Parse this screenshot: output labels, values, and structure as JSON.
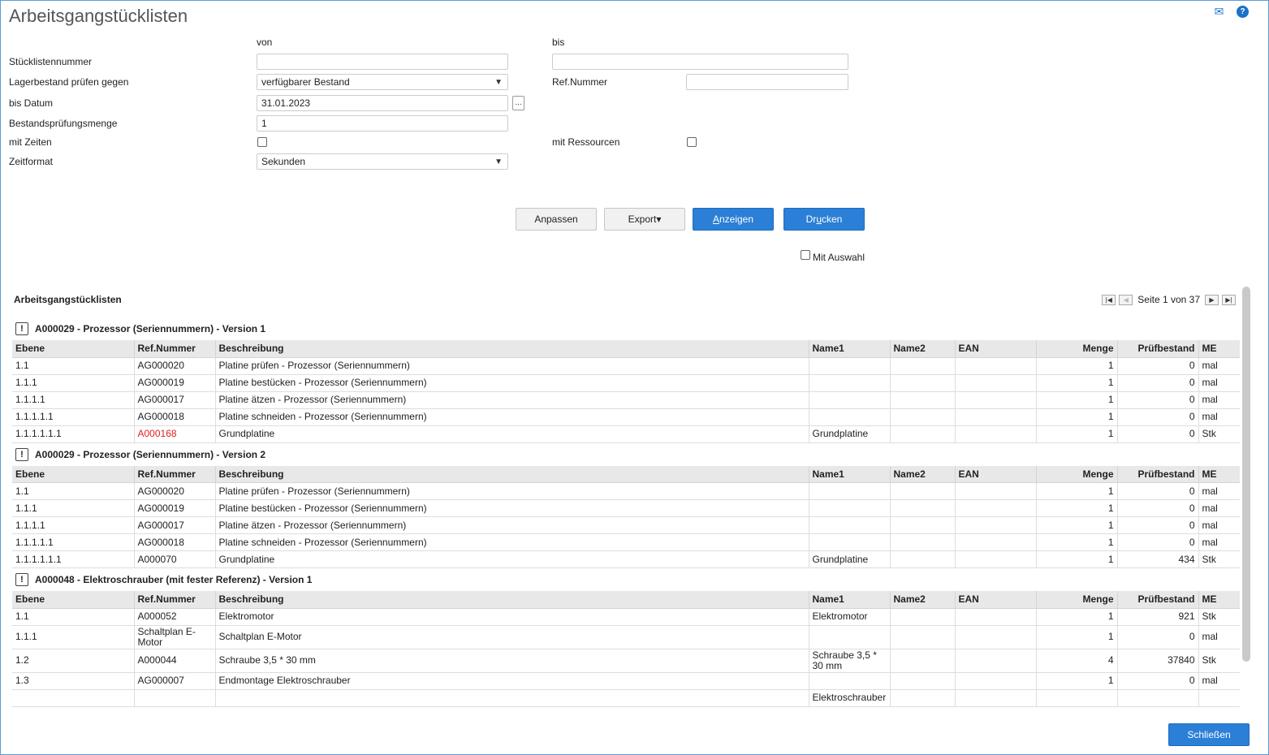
{
  "header": {
    "title": "Arbeitsgangstücklisten",
    "mail_icon": "mail-icon",
    "help_icon": "help-icon"
  },
  "form": {
    "von": "von",
    "bis": "bis",
    "stuecklistennummer_label": "Stücklistennummer",
    "lagerbestand_label": "Lagerbestand prüfen gegen",
    "lagerbestand_value": "verfügbarer Bestand",
    "refnummer_label": "Ref.Nummer",
    "bisdatum_label": "bis Datum",
    "bisdatum_value": "31.01.2023",
    "date_btn": "...",
    "menge_label": "Bestandsprüfungsmenge",
    "menge_value": "1",
    "mitzeiten_label": "mit Zeiten",
    "mitressourcen_label": "mit Ressourcen",
    "zeitformat_label": "Zeitformat",
    "zeitformat_value": "Sekunden"
  },
  "actions": {
    "anpassen": "Anpassen",
    "export": "Export▾",
    "anzeigen_u": "A",
    "anzeigen_rest": "nzeigen",
    "drucken_pre": "Dr",
    "drucken_u": "u",
    "drucken_post": "cken",
    "mit_auswahl": "Mit Auswahl",
    "schliessen": "Schließen"
  },
  "results": {
    "title": "Arbeitsgangstücklisten",
    "pager": "Seite 1 von 37",
    "columns": [
      "Ebene",
      "Ref.Nummer",
      "Beschreibung",
      "Name1",
      "Name2",
      "EAN",
      "Menge",
      "Prüfbestand",
      "ME"
    ],
    "groups": [
      {
        "title": "A000029 - Prozessor (Seriennummern) - Version 1",
        "rows": [
          {
            "ebene": "1.1",
            "ref": "AG000020",
            "beschr": "Platine prüfen - Prozessor (Seriennummern)",
            "name1": "",
            "name2": "",
            "ean": "",
            "menge": "1",
            "pruef": "0",
            "me": "mal"
          },
          {
            "ebene": "1.1.1",
            "ref": "AG000019",
            "beschr": "Platine bestücken - Prozessor (Seriennummern)",
            "name1": "",
            "name2": "",
            "ean": "",
            "menge": "1",
            "pruef": "0",
            "me": "mal"
          },
          {
            "ebene": "1.1.1.1",
            "ref": "AG000017",
            "beschr": "Platine ätzen - Prozessor (Seriennummern)",
            "name1": "",
            "name2": "",
            "ean": "",
            "menge": "1",
            "pruef": "0",
            "me": "mal"
          },
          {
            "ebene": "1.1.1.1.1",
            "ref": "AG000018",
            "beschr": "Platine schneiden - Prozessor (Seriennummern)",
            "name1": "",
            "name2": "",
            "ean": "",
            "menge": "1",
            "pruef": "0",
            "me": "mal"
          },
          {
            "ebene": "1.1.1.1.1.1",
            "ref": "A000168",
            "ref_red": true,
            "beschr": "Grundplatine",
            "name1": "Grundplatine",
            "name2": "",
            "ean": "",
            "menge": "1",
            "pruef": "0",
            "me": "Stk"
          }
        ]
      },
      {
        "title": "A000029 - Prozessor (Seriennummern) - Version 2",
        "rows": [
          {
            "ebene": "1.1",
            "ref": "AG000020",
            "beschr": "Platine prüfen - Prozessor (Seriennummern)",
            "name1": "",
            "name2": "",
            "ean": "",
            "menge": "1",
            "pruef": "0",
            "me": "mal"
          },
          {
            "ebene": "1.1.1",
            "ref": "AG000019",
            "beschr": "Platine bestücken - Prozessor (Seriennummern)",
            "name1": "",
            "name2": "",
            "ean": "",
            "menge": "1",
            "pruef": "0",
            "me": "mal"
          },
          {
            "ebene": "1.1.1.1",
            "ref": "AG000017",
            "beschr": "Platine ätzen - Prozessor (Seriennummern)",
            "name1": "",
            "name2": "",
            "ean": "",
            "menge": "1",
            "pruef": "0",
            "me": "mal"
          },
          {
            "ebene": "1.1.1.1.1",
            "ref": "AG000018",
            "beschr": "Platine schneiden - Prozessor (Seriennummern)",
            "name1": "",
            "name2": "",
            "ean": "",
            "menge": "1",
            "pruef": "0",
            "me": "mal"
          },
          {
            "ebene": "1.1.1.1.1.1",
            "ref": "A000070",
            "beschr": "Grundplatine",
            "name1": "Grundplatine",
            "name2": "",
            "ean": "",
            "menge": "1",
            "pruef": "434",
            "me": "Stk"
          }
        ]
      },
      {
        "title": "A000048 - Elektroschrauber (mit fester Referenz) - Version 1",
        "rows": [
          {
            "ebene": "1.1",
            "ref": "A000052",
            "beschr": "Elektromotor",
            "name1": "Elektromotor",
            "name2": "",
            "ean": "",
            "menge": "1",
            "pruef": "921",
            "me": "Stk"
          },
          {
            "ebene": "1.1.1",
            "ref": "Schaltplan E-Motor",
            "beschr": "Schaltplan E-Motor",
            "name1": "",
            "name2": "",
            "ean": "",
            "menge": "1",
            "pruef": "0",
            "me": "mal"
          },
          {
            "ebene": "1.2",
            "ref": "A000044",
            "beschr": "Schraube 3,5 * 30 mm",
            "name1": "Schraube 3,5 * 30 mm",
            "name2": "",
            "ean": "",
            "menge": "4",
            "pruef": "37840",
            "me": "Stk"
          },
          {
            "ebene": "1.3",
            "ref": "AG000007",
            "beschr": "Endmontage Elektroschrauber",
            "name1": "",
            "name2": "",
            "ean": "",
            "menge": "1",
            "pruef": "0",
            "me": "mal"
          },
          {
            "ebene": "",
            "ref": "",
            "beschr": "",
            "name1": "Elektroschrauber",
            "name2": "",
            "ean": "",
            "menge": "",
            "pruef": "",
            "me": ""
          }
        ]
      }
    ]
  }
}
